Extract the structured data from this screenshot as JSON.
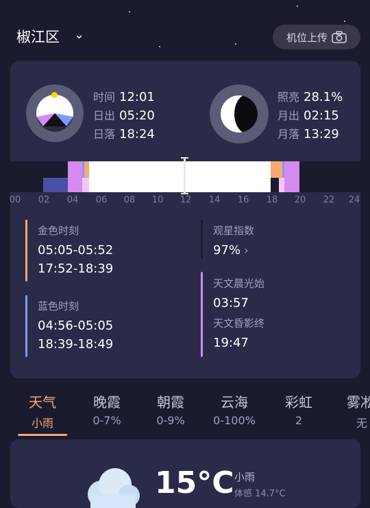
{
  "header": {
    "location": "椒江区",
    "upload_label": "机位上传"
  },
  "sun": {
    "time_label": "时间",
    "time_value": "12:01",
    "rise_label": "日出",
    "rise_value": "05:20",
    "set_label": "日落",
    "set_value": "18:24"
  },
  "moon": {
    "illum_label": "照亮",
    "illum_value": "28.1%",
    "rise_label": "月出",
    "rise_value": "02:15",
    "set_label": "月落",
    "set_value": "13:29"
  },
  "timeline": {
    "ticks": [
      "00",
      "02",
      "04",
      "06",
      "08",
      "10",
      "12",
      "14",
      "16",
      "18",
      "20",
      "22",
      "24"
    ]
  },
  "golden_hour": {
    "title": "金色时刻",
    "morning": "05:05-05:52",
    "evening": "17:52-18:39"
  },
  "blue_hour": {
    "title": "蓝色时刻",
    "morning": "04:56-05:05",
    "evening": "18:39-18:49"
  },
  "stargazing": {
    "title": "观星指数",
    "value": "97%"
  },
  "astro_dawn": {
    "title": "天文晨光始",
    "value": "03:57"
  },
  "astro_dusk": {
    "title": "天文昏影终",
    "value": "19:47"
  },
  "tabs": [
    {
      "label": "天气",
      "value": "小雨"
    },
    {
      "label": "晚霞",
      "value": "0-7%"
    },
    {
      "label": "朝霞",
      "value": "0-9%"
    },
    {
      "label": "云海",
      "value": "0-100%"
    },
    {
      "label": "彩虹",
      "value": "2"
    },
    {
      "label": "雾凇",
      "value": "无"
    }
  ],
  "weather": {
    "temperature": "15°C",
    "condition": "小雨",
    "feels_like": "体感 14.7°C"
  },
  "colors": {
    "golden": "#f7a973",
    "blue": "#7e9cf5",
    "astro": "#d78af0",
    "accent": "#f7a973"
  }
}
